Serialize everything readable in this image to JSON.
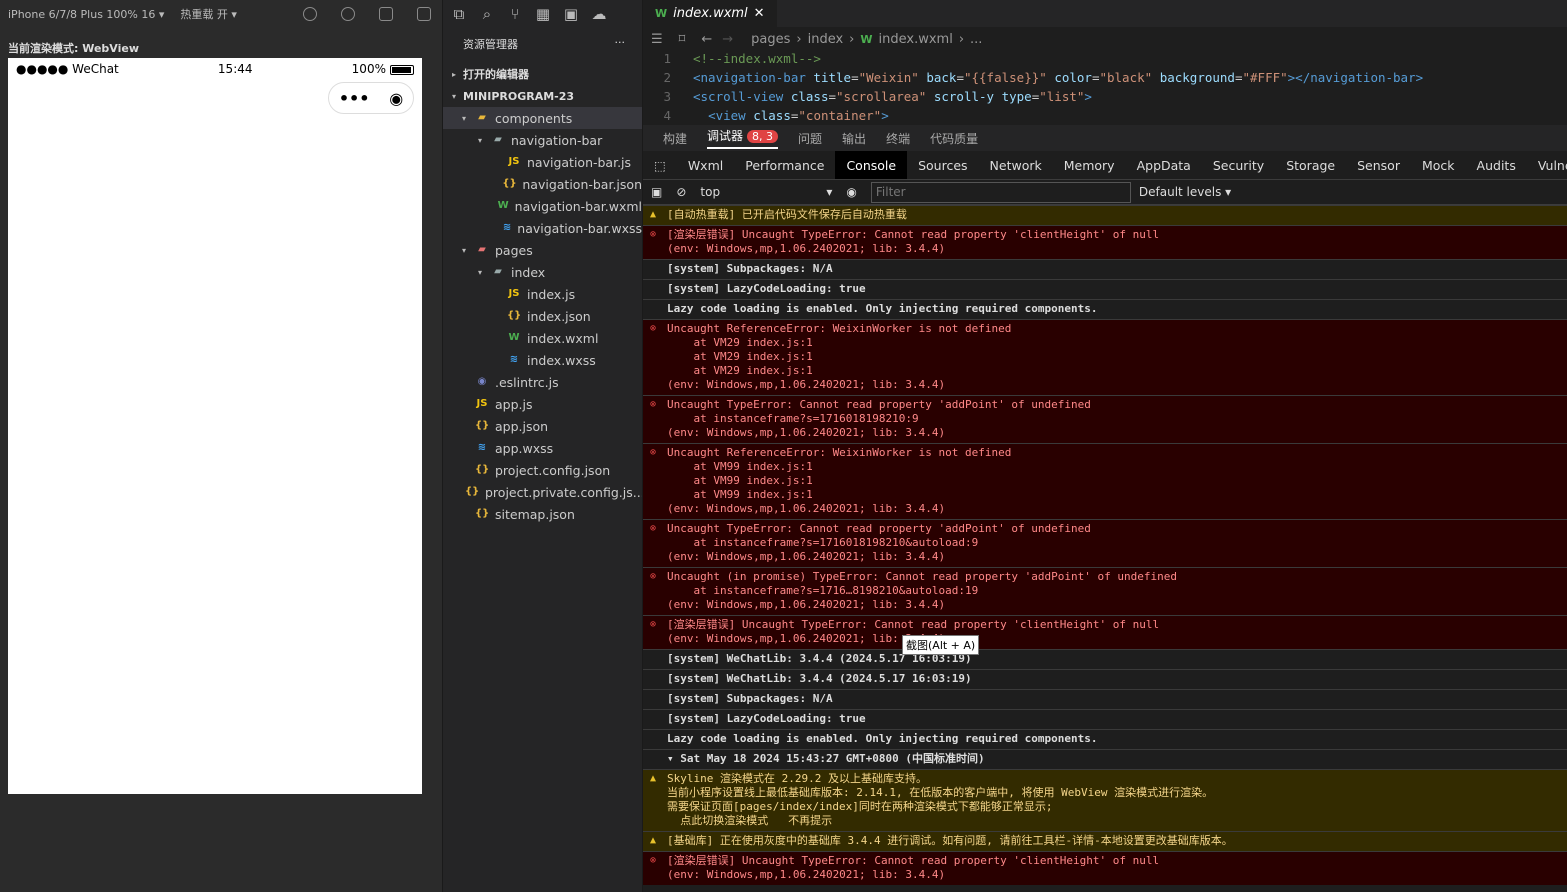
{
  "simulator": {
    "device": "iPhone 6/7/8 Plus 100% 16",
    "hot_reload": "热重载 开",
    "render_mode": "当前渲染模式: WebView",
    "signal": "●●●●● WeChat",
    "time": "15:44",
    "battery": "100%",
    "capsule_more": "•••",
    "capsule_close": "◉"
  },
  "explorer": {
    "title": "资源管理器",
    "more": "···",
    "open_editors": "打开的编辑器",
    "project": "MINIPROGRAM-23",
    "items": [
      {
        "label": "components",
        "icon": "folder",
        "depth": 1,
        "arrow": "▾",
        "sel": true,
        "color": "#e8b73a"
      },
      {
        "label": "navigation-bar",
        "icon": "folder",
        "depth": 2,
        "arrow": "▾",
        "color": "#9aa"
      },
      {
        "label": "navigation-bar.js",
        "icon": "JS",
        "depth": 3,
        "color": "#f1c40f"
      },
      {
        "label": "navigation-bar.json",
        "icon": "{}",
        "depth": 3,
        "color": "#e8b73a"
      },
      {
        "label": "navigation-bar.wxml",
        "icon": "W",
        "depth": 3,
        "color": "#4caf50"
      },
      {
        "label": "navigation-bar.wxss",
        "icon": "≋",
        "depth": 3,
        "color": "#42a5f5"
      },
      {
        "label": "pages",
        "icon": "folder",
        "depth": 1,
        "arrow": "▾",
        "color": "#e57373"
      },
      {
        "label": "index",
        "icon": "folder",
        "depth": 2,
        "arrow": "▾",
        "color": "#9aa"
      },
      {
        "label": "index.js",
        "icon": "JS",
        "depth": 3,
        "color": "#f1c40f"
      },
      {
        "label": "index.json",
        "icon": "{}",
        "depth": 3,
        "color": "#e8b73a"
      },
      {
        "label": "index.wxml",
        "icon": "W",
        "depth": 3,
        "color": "#4caf50"
      },
      {
        "label": "index.wxss",
        "icon": "≋",
        "depth": 3,
        "color": "#42a5f5"
      },
      {
        "label": ".eslintrc.js",
        "icon": "◉",
        "depth": 1,
        "color": "#7986cb"
      },
      {
        "label": "app.js",
        "icon": "JS",
        "depth": 1,
        "color": "#f1c40f"
      },
      {
        "label": "app.json",
        "icon": "{}",
        "depth": 1,
        "color": "#e8b73a"
      },
      {
        "label": "app.wxss",
        "icon": "≋",
        "depth": 1,
        "color": "#42a5f5"
      },
      {
        "label": "project.config.json",
        "icon": "{}",
        "depth": 1,
        "color": "#e8b73a"
      },
      {
        "label": "project.private.config.js...",
        "icon": "{}",
        "depth": 1,
        "color": "#e8b73a"
      },
      {
        "label": "sitemap.json",
        "icon": "{}",
        "depth": 1,
        "color": "#e8b73a"
      }
    ]
  },
  "editor": {
    "tab": "index.wxml",
    "breadcrumb": [
      "pages",
      "index",
      "index.wxml",
      "..."
    ],
    "lines": [
      {
        "n": "1",
        "html": "<span class='cm'>&lt;!--index.wxml--&gt;</span>"
      },
      {
        "n": "2",
        "html": "<span class='tg'>&lt;navigation-bar</span> <span class='at'>title</span>=<span class='st'>\"Weixin\"</span> <span class='at'>back</span>=<span class='st'>\"{{false}}\"</span> <span class='at'>color</span>=<span class='st'>\"black\"</span> <span class='at'>background</span>=<span class='st'>\"#FFF\"</span><span class='tg'>&gt;&lt;/navigation-bar&gt;</span>"
      },
      {
        "n": "3",
        "html": "<span class='tg'>&lt;scroll-view</span> <span class='at'>class</span>=<span class='st'>\"scrollarea\"</span> <span class='at'>scroll-y</span> <span class='at'>type</span>=<span class='st'>\"list\"</span><span class='tg'>&gt;</span>"
      },
      {
        "n": "4",
        "html": "  <span class='tg'>&lt;view</span> <span class='at'>class</span>=<span class='st'>\"container\"</span><span class='tg'>&gt;</span>"
      }
    ]
  },
  "devtools": {
    "tabs": [
      "构建",
      "调试器",
      "问题",
      "输出",
      "终端",
      "代码质量"
    ],
    "badge": "8, 3",
    "panels": [
      "Wxml",
      "Performance",
      "Console",
      "Sources",
      "Network",
      "Memory",
      "AppData",
      "Security",
      "Storage",
      "Sensor",
      "Mock",
      "Audits",
      "Vulnerability"
    ],
    "context": "top",
    "filter_placeholder": "Filter",
    "levels": "Default levels"
  },
  "console": [
    {
      "type": "warn",
      "h": 20,
      "text": "[自动热重载] 已开启代码文件保存后自动热重载"
    },
    {
      "type": "err",
      "h": 34,
      "text": "[渲染层错误] Uncaught TypeError: Cannot read property 'clientHeight' of null\n(env: Windows,mp,1.06.2402021; lib: 3.4.4)"
    },
    {
      "type": "info",
      "h": 20,
      "text": "[system] Subpackages: N/A"
    },
    {
      "type": "info",
      "h": 20,
      "text": "[system] LazyCodeLoading: true"
    },
    {
      "type": "info",
      "h": 20,
      "text": "Lazy code loading is enabled. Only injecting required components."
    },
    {
      "type": "err",
      "h": 76,
      "text": "Uncaught ReferenceError: WeixinWorker is not defined\n    at VM29 index.js:1\n    at VM29 index.js:1\n    at VM29 index.js:1\n(env: Windows,mp,1.06.2402021; lib: 3.4.4)"
    },
    {
      "type": "err",
      "h": 48,
      "text": "Uncaught TypeError: Cannot read property 'addPoint' of undefined\n    at instanceframe?s=1716018198210:9\n(env: Windows,mp,1.06.2402021; lib: 3.4.4)"
    },
    {
      "type": "err",
      "h": 76,
      "text": "Uncaught ReferenceError: WeixinWorker is not defined\n    at VM99 index.js:1\n    at VM99 index.js:1\n    at VM99 index.js:1\n(env: Windows,mp,1.06.2402021; lib: 3.4.4)"
    },
    {
      "type": "err",
      "h": 48,
      "text": "Uncaught TypeError: Cannot read property 'addPoint' of undefined\n    at instanceframe?s=1716018198210&autoload:9\n(env: Windows,mp,1.06.2402021; lib: 3.4.4)"
    },
    {
      "type": "err",
      "h": 48,
      "text": "Uncaught (in promise) TypeError: Cannot read property 'addPoint' of undefined\n    at instanceframe?s=1716…8198210&autoload:19\n(env: Windows,mp,1.06.2402021; lib: 3.4.4)"
    },
    {
      "type": "err",
      "h": 34,
      "text": "[渲染层错误] Uncaught TypeError: Cannot read property 'clientHeight' of null\n(env: Windows,mp,1.06.2402021; lib: 3.4.4)"
    },
    {
      "type": "info",
      "h": 20,
      "text": "[system] WeChatLib: 3.4.4 (2024.5.17 16:03:19)"
    },
    {
      "type": "info",
      "h": 20,
      "text": "[system] WeChatLib: 3.4.4 (2024.5.17 16:03:19)"
    },
    {
      "type": "info",
      "h": 20,
      "text": "[system] Subpackages: N/A"
    },
    {
      "type": "info",
      "h": 20,
      "text": "[system] LazyCodeLoading: true"
    },
    {
      "type": "info",
      "h": 20,
      "text": "Lazy code loading is enabled. Only injecting required components."
    },
    {
      "type": "info",
      "h": 20,
      "text": "▾ Sat May 18 2024 15:43:27 GMT+0800 (中国标准时间)"
    },
    {
      "type": "warn",
      "h": 62,
      "text": "Skyline 渲染模式在 2.29.2 及以上基础库支持。\n当前小程序设置线上最低基础库版本: 2.14.1, 在低版本的客户端中, 将使用 WebView 渲染模式进行渲染。\n需要保证页面[pages/index/index]同时在两种渲染模式下都能够正常显示;\n  点此切换渲染模式   不再提示"
    },
    {
      "type": "warn",
      "h": 20,
      "text": "[基础库] 正在使用灰度中的基础库 3.4.4 进行调试。如有问题, 请前往工具栏-详情-本地设置更改基础库版本。"
    },
    {
      "type": "err",
      "h": 34,
      "text": "[渲染层错误] Uncaught TypeError: Cannot read property 'clientHeight' of null\n(env: Windows,mp,1.06.2402021; lib: 3.4.4)"
    }
  ],
  "tooltip": "截图(Alt + A)"
}
